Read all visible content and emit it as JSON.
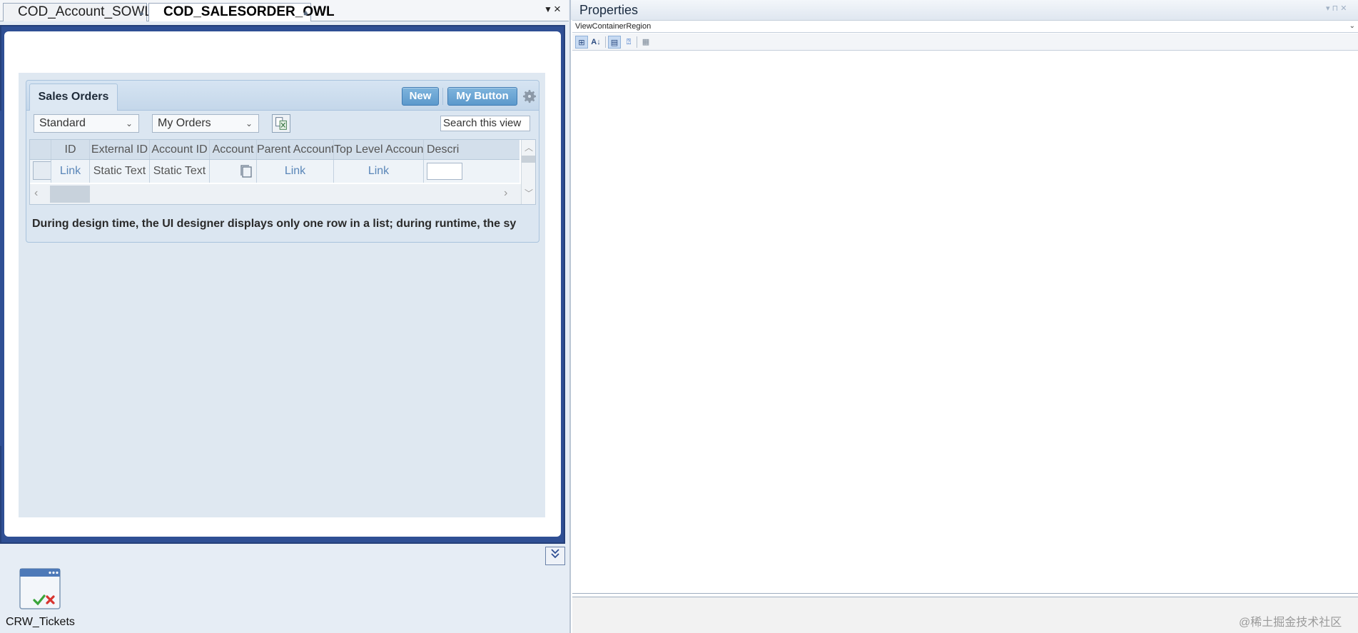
{
  "document_tabs": [
    {
      "label": "COD_Account_SOWL",
      "active": false
    },
    {
      "label": "COD_SALESORDER_OWL",
      "active": true
    }
  ],
  "panel": {
    "tab_label": "Sales Orders",
    "new_button": "New",
    "my_button": "My Button",
    "view_dropdown": "Standard",
    "filter_dropdown": "My Orders",
    "search_placeholder": "Search this view",
    "columns": [
      "ID",
      "External ID",
      "Account ID",
      "Account",
      "Parent Account",
      "Top Level Account",
      "Descri"
    ],
    "row": {
      "id": "Link",
      "external_id": "Static Text",
      "account_id": "Static Text",
      "parent_account": "Link",
      "top_level_account": "Link"
    },
    "design_note": "During design time, the UI designer displays only one row in a list; during runtime, the sy"
  },
  "bottom_tile": {
    "label": "CRW_Tickets"
  },
  "properties": {
    "title": "Properties",
    "selected_object": "ViewContainerRegion"
  },
  "watermark": "@稀土掘金技术社区",
  "colors": {
    "frame_blue": "#2f4f94",
    "button_blue": "#5c99cc",
    "link_blue": "#5a86b8"
  },
  "icons": {
    "gear": "gear-icon",
    "export": "export-excel-icon",
    "collapse": "double-chevron-down-icon",
    "tile": "window-check-x-icon"
  }
}
